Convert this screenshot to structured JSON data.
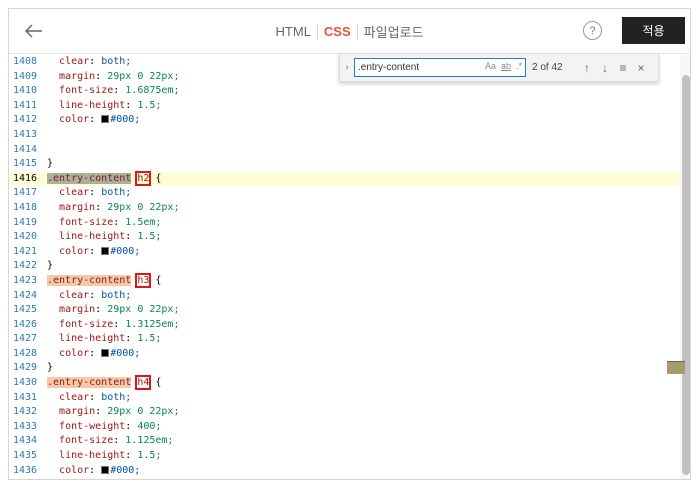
{
  "header": {
    "tabs": [
      {
        "label": "HTML",
        "active": false
      },
      {
        "label": "CSS",
        "active": true
      },
      {
        "label": "파일업로드",
        "active": false
      }
    ],
    "help_label": "?",
    "apply_label": "적용"
  },
  "find": {
    "query": ".entry-content",
    "opt_case": "Aa",
    "opt_word": "ab",
    "opt_regex": ".*",
    "count": "2 of 42"
  },
  "editor": {
    "current_line": "1416",
    "lines": [
      {
        "n": "1408",
        "prop": "clear",
        "value": "both;"
      },
      {
        "n": "1409",
        "prop": "margin",
        "value": "29px 0 22px;"
      },
      {
        "n": "1410",
        "prop": "font-size",
        "value": "1.6875em;"
      },
      {
        "n": "1411",
        "prop": "line-height",
        "value": "1.5;"
      },
      {
        "n": "1412",
        "prop": "color",
        "value": "#000;"
      },
      {
        "n": "1413"
      },
      {
        "n": "1414"
      },
      {
        "n": "1415",
        "close": "}"
      },
      {
        "n": "1416",
        "selector": ".entry-content",
        "tag": "h2",
        "brace": "{"
      },
      {
        "n": "1417",
        "prop": "clear",
        "value": "both;"
      },
      {
        "n": "1418",
        "prop": "margin",
        "value": "29px 0 22px;"
      },
      {
        "n": "1419",
        "prop": "font-size",
        "value": "1.5em;"
      },
      {
        "n": "1420",
        "prop": "line-height",
        "value": "1.5;"
      },
      {
        "n": "1421",
        "prop": "color",
        "value": "#000;"
      },
      {
        "n": "1422",
        "close": "}"
      },
      {
        "n": "1423",
        "selector": ".entry-content",
        "tag": "h3",
        "brace": "{"
      },
      {
        "n": "1424",
        "prop": "clear",
        "value": "both;"
      },
      {
        "n": "1425",
        "prop": "margin",
        "value": "29px 0 22px;"
      },
      {
        "n": "1426",
        "prop": "font-size",
        "value": "1.3125em;"
      },
      {
        "n": "1427",
        "prop": "line-height",
        "value": "1.5;"
      },
      {
        "n": "1428",
        "prop": "color",
        "value": "#000;"
      },
      {
        "n": "1429",
        "close": "}"
      },
      {
        "n": "1430",
        "selector": ".entry-content",
        "tag": "h4",
        "brace": "{"
      },
      {
        "n": "1431",
        "prop": "clear",
        "value": "both;"
      },
      {
        "n": "1432",
        "prop": "margin",
        "value": "29px 0 22px;"
      },
      {
        "n": "1433",
        "prop": "font-weight",
        "value": "400;"
      },
      {
        "n": "1434",
        "prop": "font-size",
        "value": "1.125em;"
      },
      {
        "n": "1435",
        "prop": "line-height",
        "value": "1.5;"
      },
      {
        "n": "1436",
        "prop": "color",
        "value": "#000;"
      }
    ]
  },
  "colors": {
    "accent": "#e8523c",
    "highlight_box": "#e01515",
    "current_line_bg": "#fffdd8"
  }
}
